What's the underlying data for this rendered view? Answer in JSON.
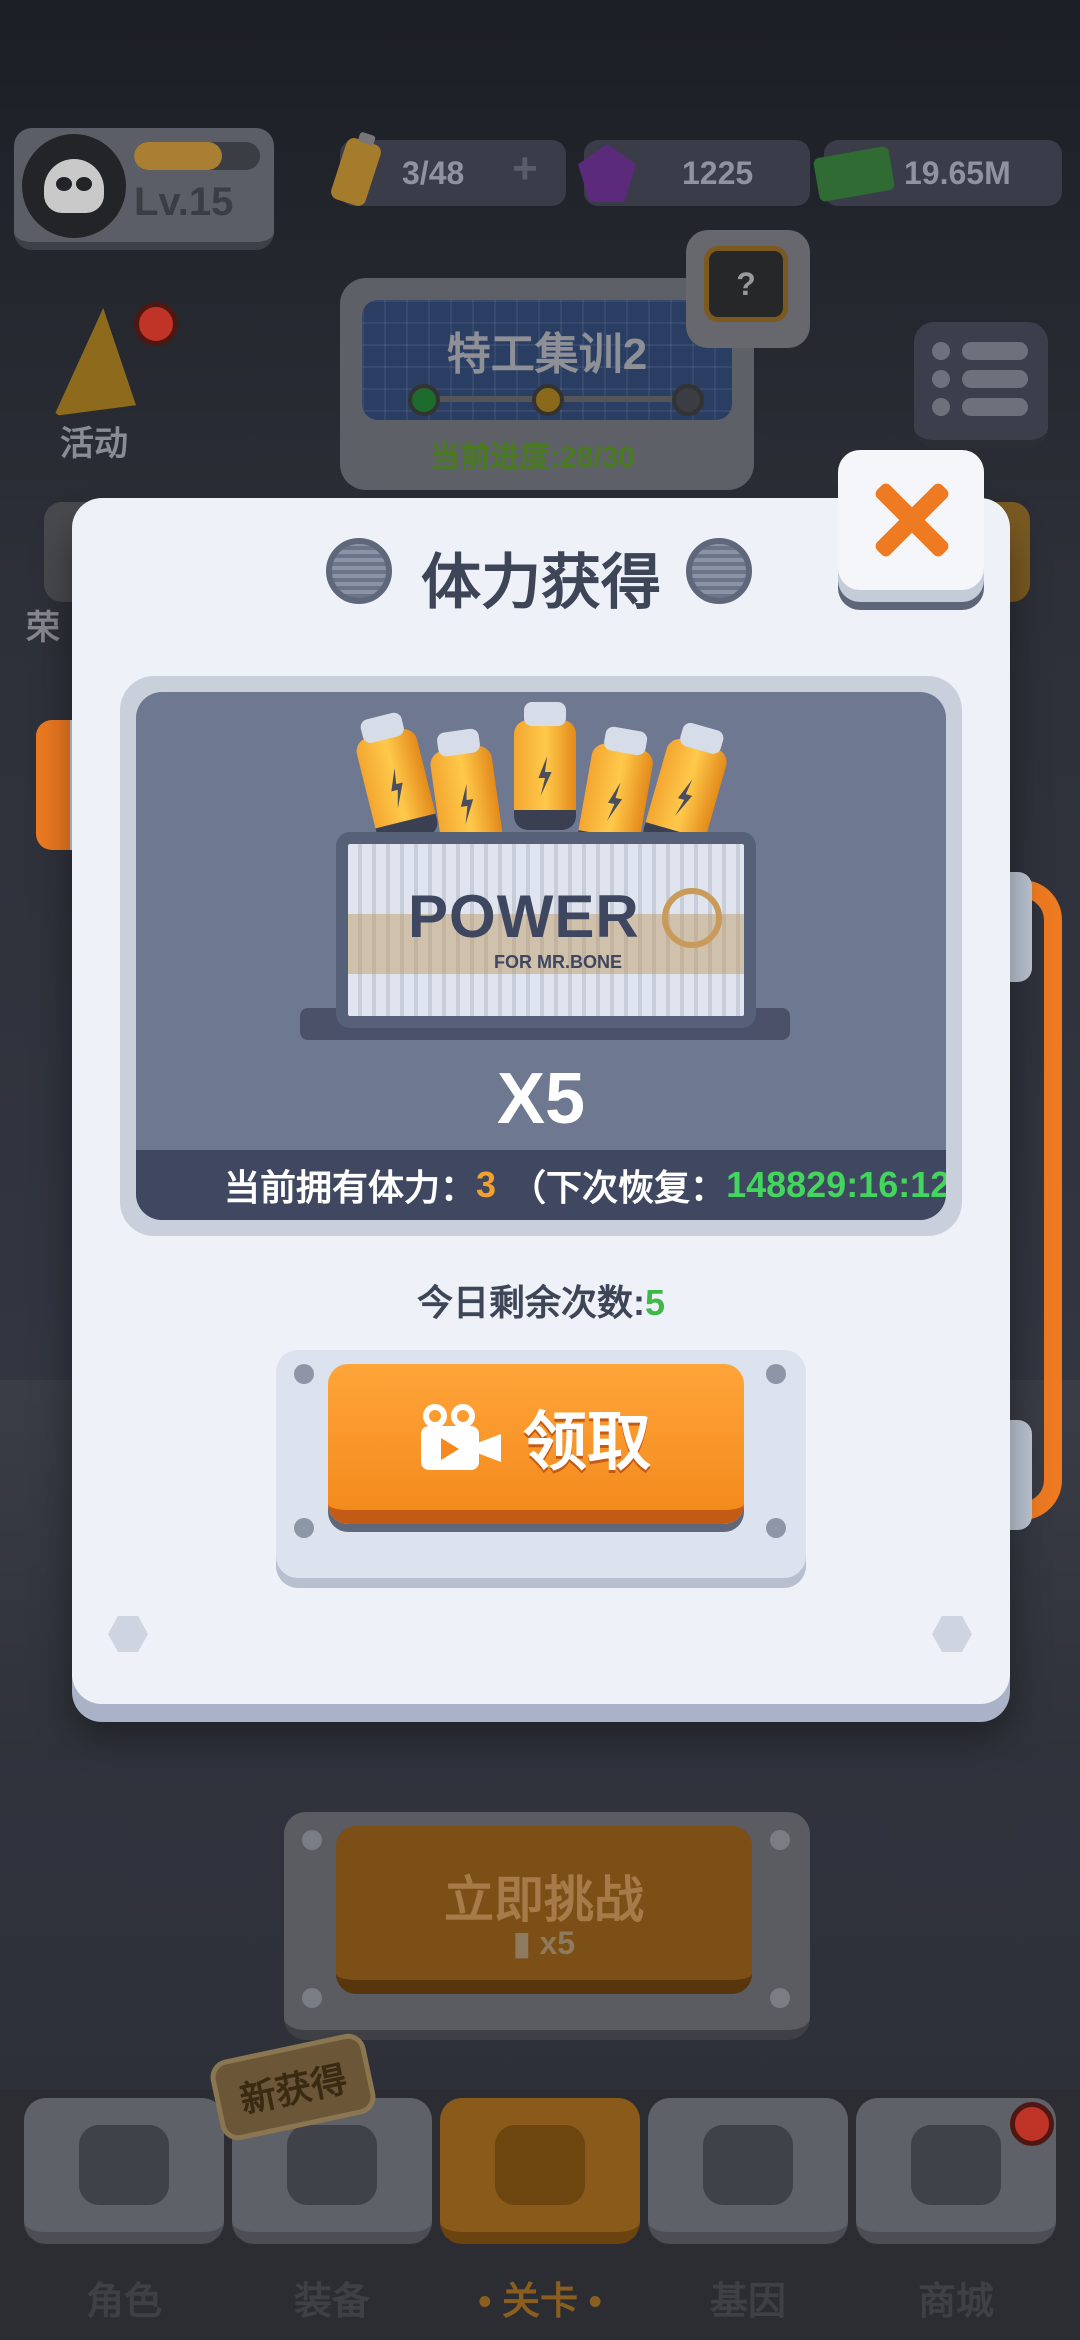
{
  "player": {
    "level": "Lv.15",
    "xp_fraction": 0.7
  },
  "resources": {
    "stamina": "3/48",
    "gems": "1225",
    "cash": "19.65M"
  },
  "event": {
    "label": "活动"
  },
  "stage": {
    "title": "特工集训2",
    "progress": "当前进度:28/30",
    "help": "?"
  },
  "side_left_partial": "荣",
  "challenge": {
    "label": "立即挑战",
    "cost": "x5"
  },
  "bottom_nav": {
    "items": [
      {
        "label": "角色",
        "icon": "skull-icon"
      },
      {
        "label": "装备",
        "icon": "gun-icon"
      },
      {
        "label": "• 关卡 •",
        "icon": "map-pin-icon"
      },
      {
        "label": "基因",
        "icon": "hexagon-icon"
      },
      {
        "label": "商城",
        "icon": "shop-icon"
      }
    ],
    "new_badge": "新获得",
    "active_index": 2
  },
  "dialog": {
    "title": "体力获得",
    "crate_text": "POWER",
    "crate_sub": "FOR MR.BONE",
    "reward_amount": "X5",
    "stamina_label": "当前拥有体力：",
    "stamina_value": "3",
    "recover_prefix": "（下次恢复：",
    "recover_time": "148829:16:12",
    "recover_suffix": "）",
    "remaining_label": "今日剩余次数:",
    "remaining_value": "5",
    "claim_label": "领取"
  },
  "colors": {
    "accent_orange": "#ee7a21",
    "recover_green": "#43d65c",
    "count_green": "#3fb84a",
    "stamina_orange": "#f4a02c"
  }
}
